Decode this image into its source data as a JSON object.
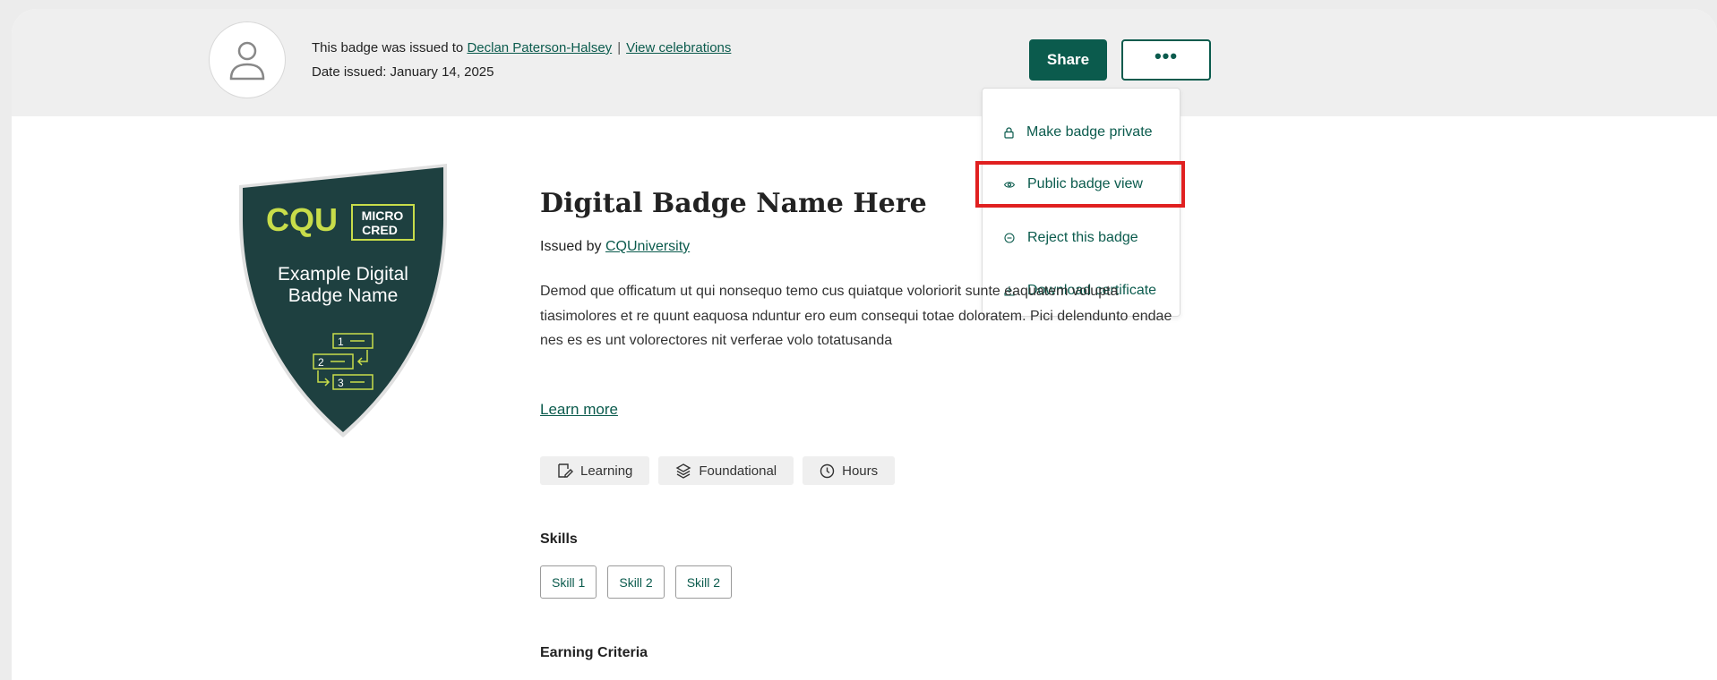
{
  "header": {
    "issued_prefix": "This badge was issued to",
    "recipient_name": "Declan Paterson-Halsey",
    "separator": "|",
    "view_celebrations": "View celebrations",
    "date_issued": "Date issued: January 14, 2025",
    "share_label": "Share",
    "more_label": "•••"
  },
  "menu": {
    "items": [
      {
        "label": "Make badge private",
        "icon": "lock-icon"
      },
      {
        "label": "Public badge view",
        "icon": "eye-icon"
      },
      {
        "label": "Reject this badge",
        "icon": "minus-circle-icon"
      },
      {
        "label": "Download certificate",
        "icon": "download-icon"
      }
    ]
  },
  "badge": {
    "logo": "CQU",
    "micro_line1": "MICRO",
    "micro_line2": "CRED",
    "name_line1": "Example Digital",
    "name_line2": "Badge Name",
    "step1": "1",
    "step2": "2",
    "step3": "3"
  },
  "main": {
    "title": "Digital Badge Name Here",
    "issued_by_prefix": "Issued by",
    "issuer": "CQUniversity",
    "description": "Demod que officatum ut qui nonsequo temo cus quiatque voloriorit          sunte eaquatem volupta tiasimolores et re quunt eaquosa nduntur          ero eum consequi totae doloratem. Pici delendunto endae nes es es unt volorectores nit verferae volo totatusanda",
    "learn_more": "Learn more",
    "tags": [
      {
        "label": "Learning",
        "icon": "learning-icon"
      },
      {
        "label": "Foundational",
        "icon": "layers-icon"
      },
      {
        "label": "Hours",
        "icon": "clock-icon"
      }
    ],
    "skills_title": "Skills",
    "skills": [
      "Skill 1",
      "Skill 2",
      "Skill 2"
    ],
    "criteria_title": "Earning Criteria"
  },
  "colors": {
    "brand_green": "#0b5b4d",
    "badge_dark": "#1e4040",
    "badge_lime": "#c8dd4a",
    "highlight_red": "#e02020"
  }
}
